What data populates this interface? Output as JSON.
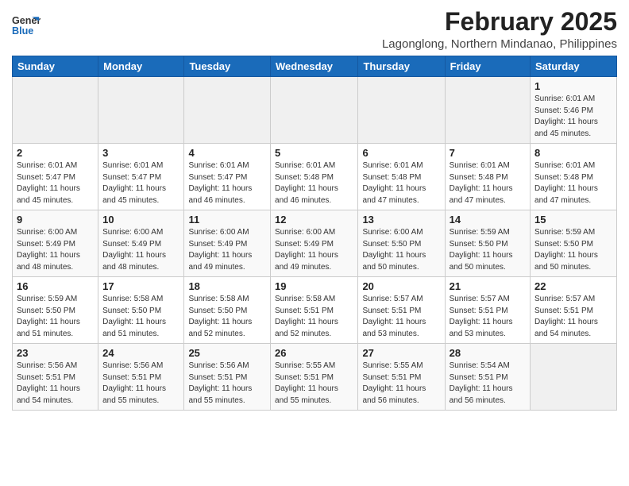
{
  "header": {
    "logo_text_general": "General",
    "logo_text_blue": "Blue",
    "month": "February 2025",
    "location": "Lagonglong, Northern Mindanao, Philippines"
  },
  "columns": [
    "Sunday",
    "Monday",
    "Tuesday",
    "Wednesday",
    "Thursday",
    "Friday",
    "Saturday"
  ],
  "weeks": [
    [
      {
        "day": "",
        "info": ""
      },
      {
        "day": "",
        "info": ""
      },
      {
        "day": "",
        "info": ""
      },
      {
        "day": "",
        "info": ""
      },
      {
        "day": "",
        "info": ""
      },
      {
        "day": "",
        "info": ""
      },
      {
        "day": "1",
        "info": "Sunrise: 6:01 AM\nSunset: 5:46 PM\nDaylight: 11 hours\nand 45 minutes."
      }
    ],
    [
      {
        "day": "2",
        "info": "Sunrise: 6:01 AM\nSunset: 5:47 PM\nDaylight: 11 hours\nand 45 minutes."
      },
      {
        "day": "3",
        "info": "Sunrise: 6:01 AM\nSunset: 5:47 PM\nDaylight: 11 hours\nand 45 minutes."
      },
      {
        "day": "4",
        "info": "Sunrise: 6:01 AM\nSunset: 5:47 PM\nDaylight: 11 hours\nand 46 minutes."
      },
      {
        "day": "5",
        "info": "Sunrise: 6:01 AM\nSunset: 5:48 PM\nDaylight: 11 hours\nand 46 minutes."
      },
      {
        "day": "6",
        "info": "Sunrise: 6:01 AM\nSunset: 5:48 PM\nDaylight: 11 hours\nand 47 minutes."
      },
      {
        "day": "7",
        "info": "Sunrise: 6:01 AM\nSunset: 5:48 PM\nDaylight: 11 hours\nand 47 minutes."
      },
      {
        "day": "8",
        "info": "Sunrise: 6:01 AM\nSunset: 5:48 PM\nDaylight: 11 hours\nand 47 minutes."
      }
    ],
    [
      {
        "day": "9",
        "info": "Sunrise: 6:00 AM\nSunset: 5:49 PM\nDaylight: 11 hours\nand 48 minutes."
      },
      {
        "day": "10",
        "info": "Sunrise: 6:00 AM\nSunset: 5:49 PM\nDaylight: 11 hours\nand 48 minutes."
      },
      {
        "day": "11",
        "info": "Sunrise: 6:00 AM\nSunset: 5:49 PM\nDaylight: 11 hours\nand 49 minutes."
      },
      {
        "day": "12",
        "info": "Sunrise: 6:00 AM\nSunset: 5:49 PM\nDaylight: 11 hours\nand 49 minutes."
      },
      {
        "day": "13",
        "info": "Sunrise: 6:00 AM\nSunset: 5:50 PM\nDaylight: 11 hours\nand 50 minutes."
      },
      {
        "day": "14",
        "info": "Sunrise: 5:59 AM\nSunset: 5:50 PM\nDaylight: 11 hours\nand 50 minutes."
      },
      {
        "day": "15",
        "info": "Sunrise: 5:59 AM\nSunset: 5:50 PM\nDaylight: 11 hours\nand 50 minutes."
      }
    ],
    [
      {
        "day": "16",
        "info": "Sunrise: 5:59 AM\nSunset: 5:50 PM\nDaylight: 11 hours\nand 51 minutes."
      },
      {
        "day": "17",
        "info": "Sunrise: 5:58 AM\nSunset: 5:50 PM\nDaylight: 11 hours\nand 51 minutes."
      },
      {
        "day": "18",
        "info": "Sunrise: 5:58 AM\nSunset: 5:50 PM\nDaylight: 11 hours\nand 52 minutes."
      },
      {
        "day": "19",
        "info": "Sunrise: 5:58 AM\nSunset: 5:51 PM\nDaylight: 11 hours\nand 52 minutes."
      },
      {
        "day": "20",
        "info": "Sunrise: 5:57 AM\nSunset: 5:51 PM\nDaylight: 11 hours\nand 53 minutes."
      },
      {
        "day": "21",
        "info": "Sunrise: 5:57 AM\nSunset: 5:51 PM\nDaylight: 11 hours\nand 53 minutes."
      },
      {
        "day": "22",
        "info": "Sunrise: 5:57 AM\nSunset: 5:51 PM\nDaylight: 11 hours\nand 54 minutes."
      }
    ],
    [
      {
        "day": "23",
        "info": "Sunrise: 5:56 AM\nSunset: 5:51 PM\nDaylight: 11 hours\nand 54 minutes."
      },
      {
        "day": "24",
        "info": "Sunrise: 5:56 AM\nSunset: 5:51 PM\nDaylight: 11 hours\nand 55 minutes."
      },
      {
        "day": "25",
        "info": "Sunrise: 5:56 AM\nSunset: 5:51 PM\nDaylight: 11 hours\nand 55 minutes."
      },
      {
        "day": "26",
        "info": "Sunrise: 5:55 AM\nSunset: 5:51 PM\nDaylight: 11 hours\nand 55 minutes."
      },
      {
        "day": "27",
        "info": "Sunrise: 5:55 AM\nSunset: 5:51 PM\nDaylight: 11 hours\nand 56 minutes."
      },
      {
        "day": "28",
        "info": "Sunrise: 5:54 AM\nSunset: 5:51 PM\nDaylight: 11 hours\nand 56 minutes."
      },
      {
        "day": "",
        "info": ""
      }
    ]
  ]
}
